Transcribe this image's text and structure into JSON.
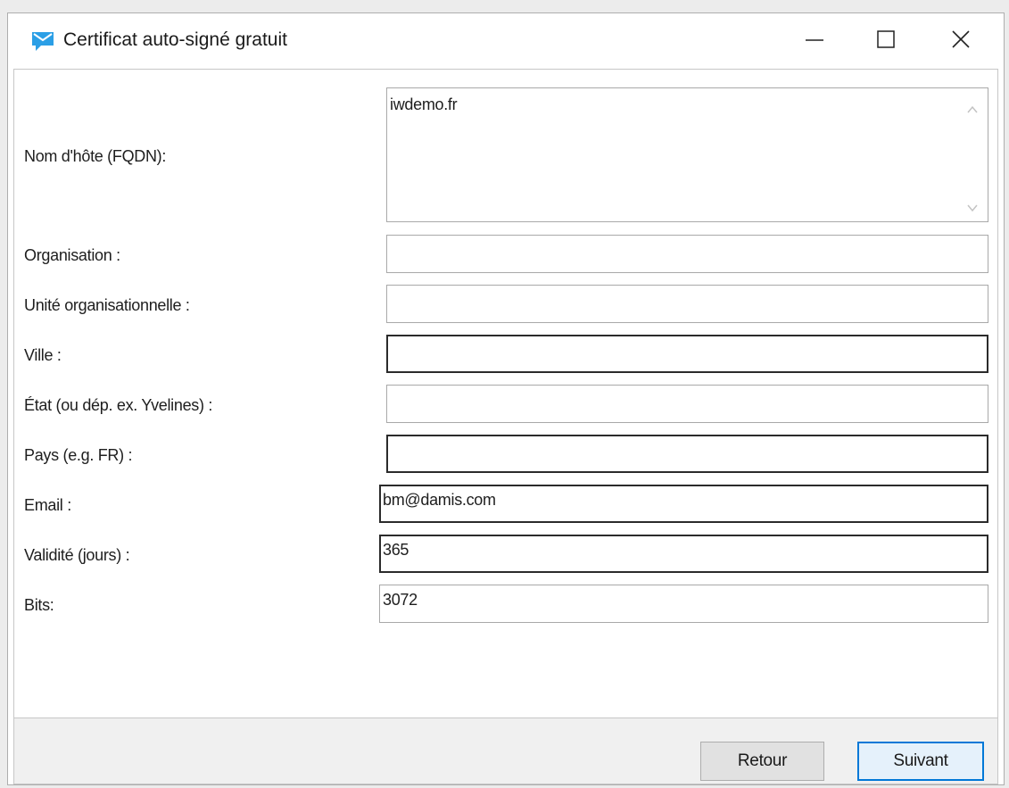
{
  "window": {
    "title": "Certificat auto-signé gratuit",
    "app_icon": "envelope-chat-icon",
    "controls": {
      "minimize": "minimize-icon",
      "maximize": "maximize-icon",
      "close": "close-icon"
    }
  },
  "form": {
    "hostname": {
      "label": "Nom d'hôte (FQDN):",
      "value": "iwdemo.fr"
    },
    "organisation": {
      "label": "Organisation :",
      "value": ""
    },
    "unit": {
      "label": "Unité organisationnelle :",
      "value": ""
    },
    "city": {
      "label": "Ville :",
      "value": ""
    },
    "state": {
      "label": "État (ou dép. ex. Yvelines) :",
      "value": ""
    },
    "country": {
      "label": "Pays (e.g. FR) :",
      "value": ""
    },
    "email": {
      "label": "Email :",
      "value": "bm@damis.com"
    },
    "validity": {
      "label": "Validité (jours) :",
      "value": "365"
    },
    "bits": {
      "label": "Bits:",
      "value": "3072"
    }
  },
  "footer": {
    "back_label": "Retour",
    "next_label": "Suivant"
  },
  "colors": {
    "accent": "#0078d7",
    "icon_blue": "#2b9fe6"
  }
}
